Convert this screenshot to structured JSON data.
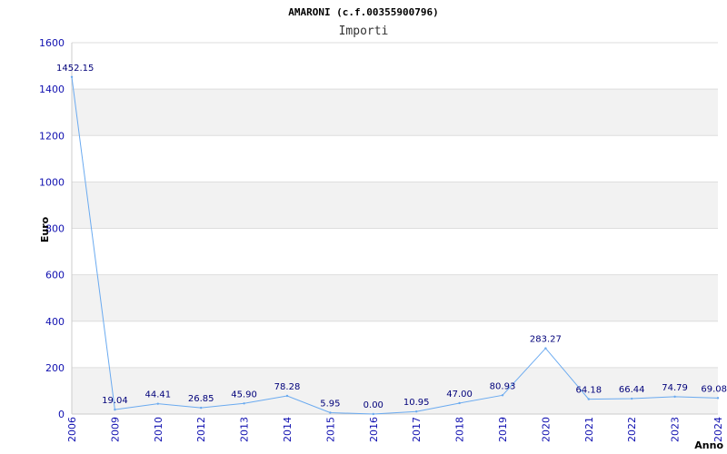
{
  "chart_data": {
    "type": "line",
    "title": "AMARONI (c.f.00355900796)",
    "subtitle": "Importi",
    "xlabel": "Anno",
    "ylabel": "Euro",
    "categories": [
      "2006",
      "2009",
      "2010",
      "2012",
      "2013",
      "2014",
      "2015",
      "2016",
      "2017",
      "2018",
      "2019",
      "2020",
      "2021",
      "2022",
      "2023",
      "2024"
    ],
    "values": [
      1452.15,
      19.04,
      44.41,
      26.85,
      45.9,
      78.28,
      5.95,
      0.0,
      10.95,
      47.0,
      80.93,
      283.27,
      64.18,
      66.44,
      74.79,
      69.08
    ],
    "value_labels": [
      "1452.15",
      "19.04",
      "44.41",
      "26.85",
      "45.90",
      "78.28",
      "5.95",
      "0.00",
      "10.95",
      "47.00",
      "80.93",
      "283.27",
      "64.18",
      "66.44",
      "74.79",
      "69.08"
    ],
    "ylim": [
      0,
      1600
    ],
    "yticks": [
      "0",
      "200",
      "400",
      "600",
      "800",
      "1000",
      "1200",
      "1400",
      "1600"
    ],
    "grid": true,
    "legend": "none",
    "colors": {
      "line": "#6aaaf0",
      "band": "#f2f2f2",
      "grid": "#dddddd",
      "tick_text": "#1010b0",
      "label_text": "#00007a"
    }
  }
}
